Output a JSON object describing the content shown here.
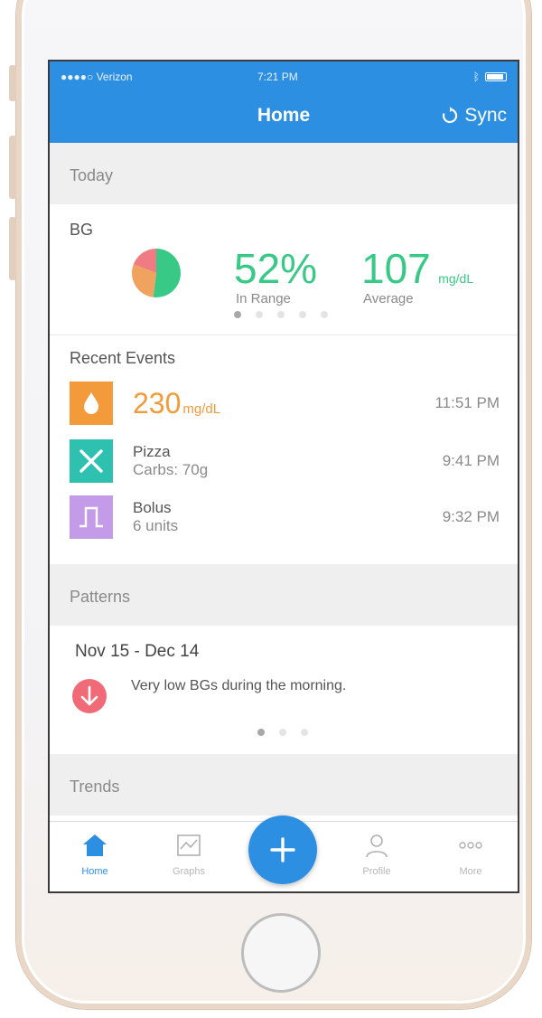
{
  "status_bar": {
    "carrier": "●●●●○ Verizon",
    "time": "7:21 PM"
  },
  "nav": {
    "title": "Home",
    "sync_label": "Sync"
  },
  "today": {
    "header": "Today",
    "bg_label": "BG",
    "pie": {
      "in_range_fraction": 0.52,
      "colors": [
        "#38c987",
        "#f0a35e",
        "#f07c83"
      ]
    },
    "in_range_value": "52%",
    "in_range_label": "In Range",
    "average_value": "107",
    "average_unit": "mg/dL",
    "average_label": "Average",
    "pager": {
      "count": 5,
      "active": 0
    }
  },
  "recent_events": {
    "title": "Recent Events",
    "items": [
      {
        "icon": "blood-drop-icon",
        "color": "#f39a3a",
        "value": "230",
        "unit": "mg/dL",
        "time": "11:51 PM"
      },
      {
        "icon": "fork-knife-icon",
        "color": "#2fc1b0",
        "line1": "Pizza",
        "line2": "Carbs: 70g",
        "time": "9:41 PM"
      },
      {
        "icon": "bolus-icon",
        "color": "#c49be8",
        "line1": "Bolus",
        "line2": "6 units",
        "time": "9:32 PM"
      }
    ]
  },
  "patterns": {
    "header": "Patterns",
    "date_range": "Nov 15 - Dec 14",
    "item_icon": "arrow-down-icon",
    "item_color": "#f06a78",
    "item_text": "Very low BGs during the morning.",
    "pager": {
      "count": 3,
      "active": 0
    }
  },
  "trends": {
    "header": "Trends"
  },
  "tabbar": {
    "accent": "#2d8fe2",
    "tabs": [
      {
        "label": "Home",
        "icon": "home-icon",
        "active": true
      },
      {
        "label": "Graphs",
        "icon": "graph-icon",
        "active": false
      },
      {
        "label": "Profile",
        "icon": "person-icon",
        "active": false
      },
      {
        "label": "More",
        "icon": "more-icon",
        "active": false
      }
    ],
    "add_icon": "plus-icon"
  }
}
